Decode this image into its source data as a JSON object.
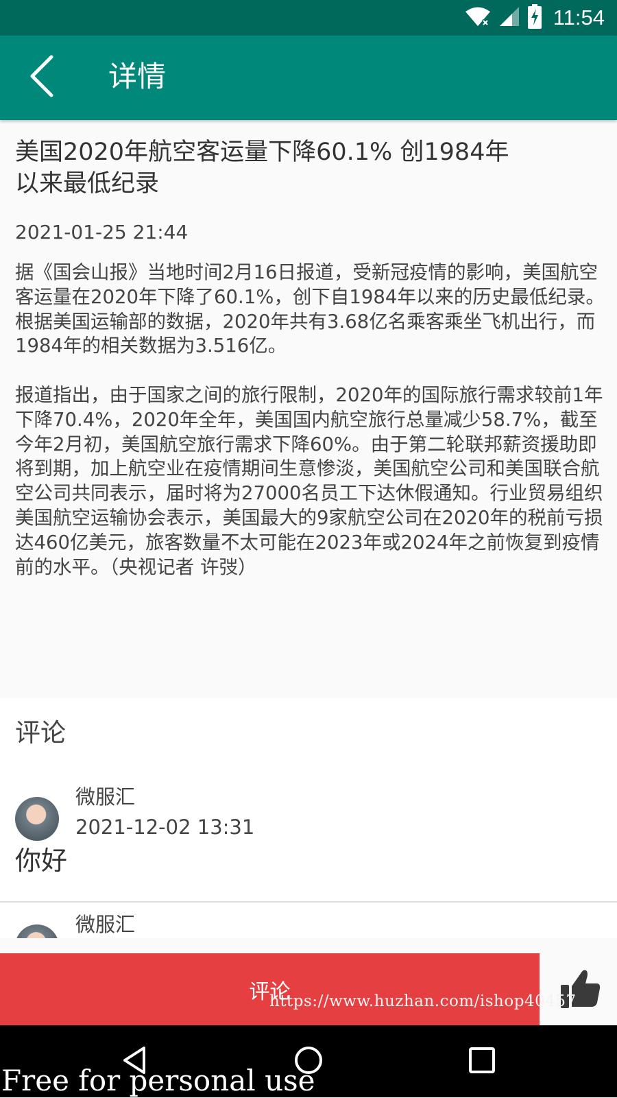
{
  "status_bar": {
    "time": "11:54",
    "icons": [
      "wifi-icon",
      "signal-icon",
      "battery-charging-icon"
    ]
  },
  "app_bar": {
    "title": "详情",
    "back_icon": "back-arrow-icon"
  },
  "article": {
    "title": "美国2020年航空客运量下降60.1% 创1984年以来最低纪录",
    "date": "2021-01-25 21:44",
    "paragraphs": [
      "据《国会山报》当地时间2月16日报道，受新冠疫情的影响，美国航空客运量在2020年下降了60.1%，创下自1984年以来的历史最低纪录。根据美国运输部的数据，2020年共有3.68亿名乘客乘坐飞机出行，而1984年的相关数据为3.516亿。",
      "报道指出，由于国家之间的旅行限制，2020年的国际旅行需求较前1年下降70.4%，2020年全年，美国国内航空旅行总量减少58.7%，截至今年2月初，美国航空旅行需求下降60%。由于第二轮联邦薪资援助即将到期，加上航空业在疫情期间生意惨淡，美国航空公司和美国联合航空公司共同表示，届时将为27000名员工下达休假通知。行业贸易组织美国航空运输协会表示，美国最大的9家航空公司在2020年的税前亏损达460亿美元，旅客数量不太可能在2023年或2024年之前恢复到疫情前的水平。（央视记者 许弢）"
    ]
  },
  "comments": {
    "title": "评论",
    "items": [
      {
        "user": "微服汇",
        "time": "2021-12-02 13:31",
        "content": "你好"
      },
      {
        "user": "微服汇"
      }
    ]
  },
  "action_bar": {
    "comment_label": "评论",
    "like_icon": "thumbs-up-icon",
    "accent_color": "#e53f41"
  },
  "watermarks": {
    "url": "https://www.huzhan.com/ishop40457",
    "free": "Free for personal use"
  },
  "nav_bar": {
    "icons": [
      "back-triangle-icon",
      "home-circle-icon",
      "recents-square-icon"
    ]
  },
  "colors": {
    "status_bar": "#00695c",
    "app_bar": "#00897b"
  }
}
